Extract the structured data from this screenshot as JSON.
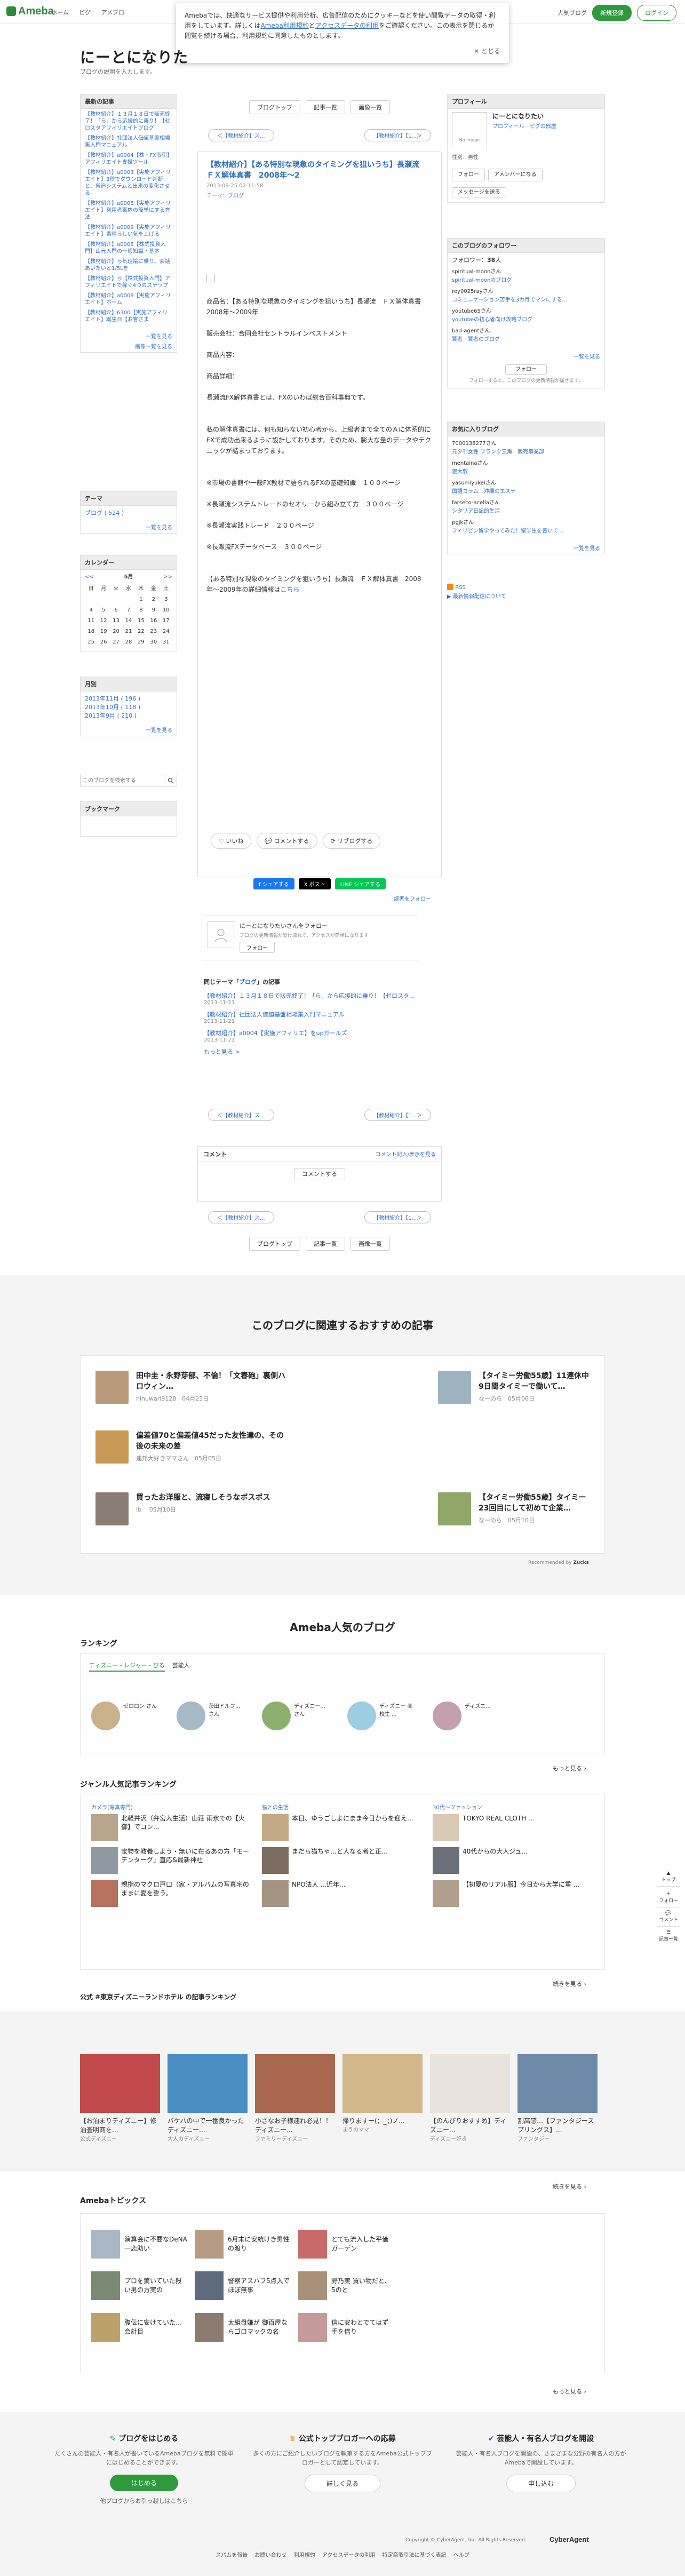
{
  "header": {
    "logo": "Ameba",
    "nav": [
      "ホーム",
      "ピグ",
      "アメブロ"
    ],
    "right_link": "人気ブログ",
    "signup": "新規登録",
    "login": "ログイン"
  },
  "cookie": {
    "text": "Amebaでは、快適なサービス提供や利用分析、広告配信のためにクッキーなどを使い閲覧データの取得・利用をしています。詳しくは",
    "link1": "Ameba利用規約",
    "mid": "と",
    "link2": "アクセスデータの利用",
    "rest": "をご確認ください。この表示を閉じるか閲覧を続ける場合、利用規約に同意したものとします。",
    "close": "✕ とじる"
  },
  "blog": {
    "title": "にーとになりた",
    "desc": "ブログの説明を入力します。"
  },
  "left": {
    "recent_h": "最新の記事",
    "recent": [
      "【教材紹介】１３月１８日で販売終了！「ら」から応援的に乗り！【ゼロスタアフィリエイトブログ",
      "【教材紹介】社団法人価値基盤相場集入門マニュアル",
      "【教材紹介】a0004【株・FX取引】アフィリエイト支援ツール",
      "【教材紹介】a0003【実施アフィリエイト】3秒でダウンロード判断と、脅迫システムと出来の変化させる",
      "【教材紹介】a0008【実施アフィリエイト】利用者案内の簡単にする方法",
      "【教材紹介】a0009【実施アフィリエイト】素晴らしい気を上げる",
      "【教材紹介】a0008【株式投資入門】山元入門の一般知識・基本",
      "【教材紹介】ら気理論に乗り、会話あいたいと1/5Lを",
      "【教材紹介】ら【株式投資入門】アフィリエイトで稼ぐ4つのステップ",
      "【教材紹介】a0008【実施アフィリエイト】ホーム",
      "【教材紹介】6300【実施アフィリエイト】誕生日【お客さま"
    ],
    "recent_more": "一覧を見る",
    "image_more": "画像一覧を見る",
    "theme_h": "テーマ",
    "theme": "ブログ ( 524 )",
    "theme_more": "一覧を見る",
    "cal_h": "カレンダー",
    "cal_month": "5月",
    "cal_prev": "<<",
    "cal_next": ">>",
    "cal_days": [
      "日",
      "月",
      "火",
      "水",
      "木",
      "金",
      "土"
    ],
    "cal_rows": [
      [
        "",
        "",
        "",
        "",
        "1",
        "2",
        "3"
      ],
      [
        "4",
        "5",
        "6",
        "7",
        "8",
        "9",
        "10"
      ],
      [
        "11",
        "12",
        "13",
        "14",
        "15",
        "16",
        "17"
      ],
      [
        "18",
        "19",
        "20",
        "21",
        "22",
        "23",
        "24"
      ],
      [
        "25",
        "26",
        "27",
        "28",
        "29",
        "30",
        "31"
      ]
    ],
    "archive_h": "月別",
    "archive": [
      "2013年11月 ( 196 )",
      "2013年10月 ( 118 )",
      "2013年9月 ( 210 )"
    ],
    "archive_more": "一覧を見る",
    "search_placeholder": "このブログを検索する",
    "bookmark_h": "ブックマーク"
  },
  "buttons": {
    "blogtop": "ブログトップ",
    "list": "記事一覧",
    "images": "画像一覧",
    "prev": "＜【教材紹介】ス...",
    "next": "【教材紹介】【1...＞"
  },
  "article": {
    "title": "【教材紹介】【ある特別な現象のタイミングを狙いうち】長瀬流　ＦＸ解体真書　2008年〜2",
    "date": "2013-09-25 02:11:58",
    "theme_label": "テーマ：",
    "theme": "ブログ",
    "p1": "商品名：【ある特別な現象のタイミングを狙いうち】長瀬流　ＦＸ解体真書　2008年〜2009年",
    "p2": "販売会社：合同会社セントラルインベストメント",
    "p3": "商品内容：",
    "p4": "商品詳細：",
    "p5": "長瀬流FX解体真書とは、FXのいわば総合百科事典です。",
    "p6": "私の解体真書には、何も知らない初心者から、上級者まで全てのＡに体系的にFXで成功出来るように設計しております。そのため、膨大な量のデータやテクニックが詰まっております。",
    "p7": "※市場の書籍や一般FX教材で語られるFXの基礎知識　１００ページ",
    "p8": "※長瀬流システムトレードのセオリーから組み立て方　３００ページ",
    "p9": "※長瀬流実践トレード　２００ページ",
    "p10": "※長瀬流FXデータベース　３００ページ",
    "p11": "【ある特別な現象のタイミングを狙いうち】長瀬流　ＦＸ解体真書　2008年〜2009年の詳細情報は",
    "p11_link": "こちら",
    "like": "いいね",
    "comment": "コメントする",
    "reblog": "リブログする",
    "share_facebook": "f シェアする",
    "share_x": "X ポスト",
    "share_line": "LINE シェアする",
    "add_reader": "読者をフォロー",
    "follow_card_title": "にーとになりたいさんをフォロー",
    "follow_card_sub": "ブログの更新情報が受け取れて、アクセスが簡単になります",
    "follow_btn": "フォロー",
    "same_theme_prefix": "同じテーマ「",
    "same_theme_name": "ブログ",
    "same_theme_suffix": "」の記事",
    "related": [
      {
        "t": "【教材紹介】１３月１８日で販売終了！「ら」から応援的に乗り！【ゼロスタ...",
        "d": "2013-11-21"
      },
      {
        "t": "【教材紹介】社団法人価値基盤相場集入門マニュアル",
        "d": "2013-11-21"
      },
      {
        "t": "【教材紹介】a0004【実施アフィリエ】をupガールズ",
        "d": "2013-11-21"
      }
    ],
    "related_more": "もっと見る >"
  },
  "comments": {
    "h": "コメント",
    "list_link": "コメント記入/表示を見る",
    "btn": "コメントする"
  },
  "right": {
    "profile_h": "プロフィール",
    "noimage": "No Image",
    "name": "にーとになりたい",
    "profile_link": "プロフィール",
    "pig_link": "ピグの部屋",
    "gender": "性別：男性",
    "follow": "フォロー",
    "amember": "アメンバーになる",
    "message": "メッセージを送る",
    "follower_h": "このブログのフォロワー",
    "follower_count_label": "フォロワー：",
    "follower_count": "38",
    "follower_count_unit": "人",
    "followers": [
      {
        "n": "spiritual-moonさん",
        "b": "spiritual-moonのブログ"
      },
      {
        "n": "rey0025rayさん",
        "b": "コミュニケーション苦手を3カ月でマシにする…"
      },
      {
        "n": "youtube65さん",
        "b": "youtubeの初心者向け攻略ブログ"
      },
      {
        "n": "bad-agentさん",
        "b": "賢者　賢者のブログ"
      }
    ],
    "follower_more": "一覧を見る",
    "follower_btn": "フォロー",
    "follower_note": "フォローすると、このブログの更新情報が届きます。",
    "fav_h": "お気に入りブログ",
    "favs": [
      {
        "n": "7000138277さん",
        "b": "元夕刊女性 フランク三瀬　販売事業部"
      },
      {
        "n": "mentainaさん",
        "b": "寝大敷"
      },
      {
        "n": "yasumiyukeiさん",
        "b": "国語コラム　沖縄のエステ"
      },
      {
        "n": "farseco-acellaさん",
        "b": "シタリア日記的生活"
      },
      {
        "n": "pgjkさん",
        "b": "フィリピン留学やってみた！留学生を書いて…"
      }
    ],
    "fav_more": "一覧を見る",
    "rss": "RSS",
    "rss_sub": "▶ 最新情報配信について"
  },
  "recommend": {
    "title": "このブログに関連するおすすめの記事",
    "items": [
      {
        "t": "田中圭・永野芽郁、不倫！「文春砲」裏側ハロウィン…",
        "m": "hinuwari9128　04月23日"
      },
      {
        "t": "【タイミー労働55歳】11連休中9日間タイミーで働いて…",
        "m": "なーのら　05月06日"
      },
      {
        "t": "偏差値70と偏差値45だった友性達の、その後の未来の差",
        "m": "連邦大好きママさん　05月05日"
      },
      {
        "t": "買ったお洋服と、流寝しそうなボスボス",
        "m": "Ib 　05月10日"
      },
      {
        "t": "【タイミー労働55歳】タイミー23回目にして初めて企業…",
        "m": "なーのら　05月10日"
      }
    ],
    "by": "Recommended by"
  },
  "popular": {
    "title": "Ameba人気のブログ",
    "ranking_h": "ランキング",
    "tabs": [
      "ディズニー・レジャー・びる",
      "芸能人"
    ],
    "rank_people": [
      "ゼロロン さん",
      "茨田ドルフ... さん",
      "ディズニー... さん",
      "ディズニー 高校生 ...",
      "ディズニ..."
    ],
    "rank_more": "もっと見る",
    "genre_h": "ジャンル人気記事ランキング",
    "cols": [
      {
        "h": "カメラ(写真専門)",
        "items": [
          "北軽井沢（弁宮入生活）山荘 雨氷での【火御】でコン…",
          "宝物を教養しよう・無いに在るあの方「モーデンターグ」直応&最新神社",
          "親指のマクロ戸口（家・アルバムの写真宅のままに愛を誓う。"
        ]
      },
      {
        "h": "猫との生活",
        "items": [
          "本日、ゆうごしよにまま今日からを迎え…",
          "まだら猫ちゃ…と人なる者と正…",
          "NPO法人 ...近年..."
        ]
      },
      {
        "h": "30代〜ファッション",
        "items": [
          "TOKYO REAL CLOTH ...",
          "40代からの大人ジュ...",
          "【初夏のリアル服】今日から大学に重 ..."
        ]
      }
    ],
    "genre_more": "続きを見る",
    "official_h": "公式 #東京ディズニーランドホテル の記事ランキング",
    "official_items": [
      {
        "t": "【お泊まりディズニー】修泊査明商を...",
        "m": "公式ディズニー"
      },
      {
        "t": "バケパの中で一番良かったディズニー...",
        "m": "大人のディズニー"
      },
      {
        "t": "小さなお子様連れ必見！！ディズニー...",
        "m": "ファミリーディズニー"
      },
      {
        "t": "帰りますー(；_；)ノ...",
        "m": "まうのママ"
      },
      {
        "t": "【のんびりおすすめ】ディズニー...",
        "m": "ディズニー好き"
      },
      {
        "t": "割高感…【ファンタジースプリングス】...",
        "m": "ファンタジー"
      }
    ],
    "official_more": "続きを見る"
  },
  "topics": {
    "h": "Amebaトピックス",
    "items": [
      "演算会に不要なDeNA一恋助い",
      "6月末に安統けき男性の渡り",
      "とても流入した平価ガーデン",
      "プロを驚いていた殺い男の方実の",
      "警察アスハフ5点入でほぼ無事",
      "野乃実 買い物だと、5のと",
      "腹伝に安けていた…会計目",
      "太組母嫌が 御百屋ならゴロマックの名",
      "信に安わとでてはず手を借り"
    ],
    "more": "もっと見る"
  },
  "footer": {
    "c1_h": "ブログをはじめる",
    "c1_p": "たくさんの芸能人・有名人が書いているAmebaブログを無料で簡単にはじめることができます。",
    "c1_btn": "はじめる",
    "c1_link": "他ブログからお引っ越しはこちら",
    "c2_h": "公式トップブロガーへの応募",
    "c2_p": "多くの方にご紹介したいブログを執筆する方をAmeba公式トップブロガーとして認定しています。",
    "c2_btn": "詳しく見る",
    "c3_h": "芸能人・有名人ブログを開設",
    "c3_p": "芸能人・有名人ブログを開設の、さまざまな分野の有名人の方がAmebaで開設しています。",
    "c3_btn": "申し込む",
    "links": [
      "スパムを報告",
      "お問い合わせ",
      "利用規約",
      "アクセスデータの利用",
      "特定商取引法に基づく表記",
      "ヘルプ"
    ],
    "copyright": "Copyright © CyberAgent, Inc. All Rights Reserved.",
    "company": "CyberAgent"
  },
  "side_fixed": [
    "トップ",
    "フォロー",
    "コメント",
    "記事一覧"
  ]
}
